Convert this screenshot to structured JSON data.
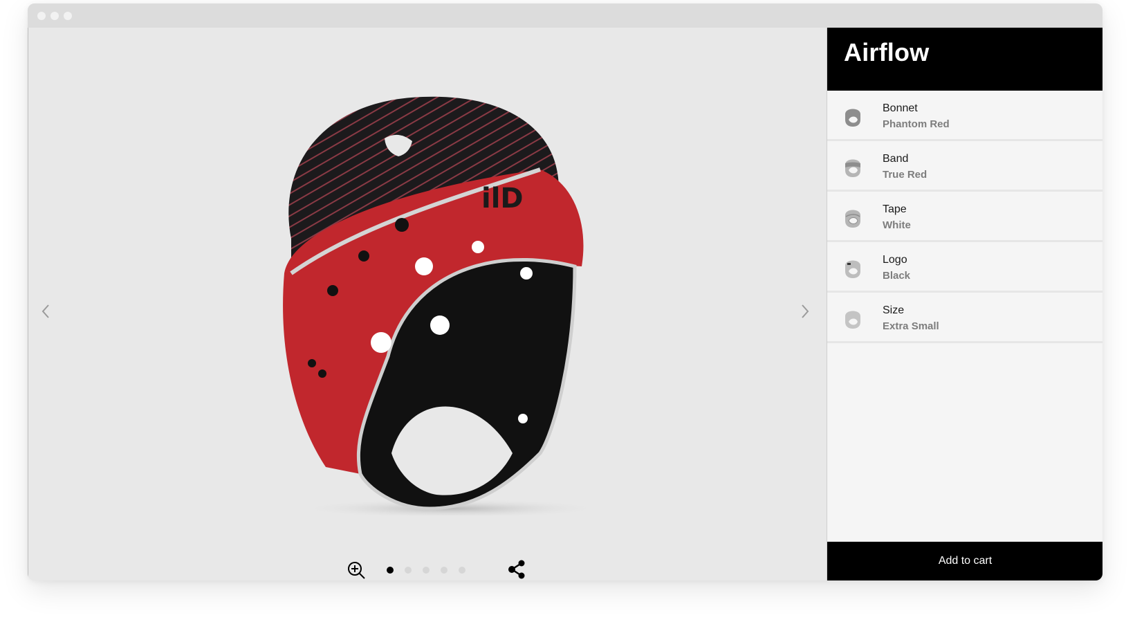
{
  "window": {
    "controls": [
      "close",
      "minimize",
      "maximize"
    ]
  },
  "viewer": {
    "prev_icon": "chevron-left-icon",
    "next_icon": "chevron-right-icon",
    "zoom_icon": "zoom-in-icon",
    "share_icon": "share-icon",
    "pages": 5,
    "active_page": 1,
    "product_image": "rugby-headguard-red-black"
  },
  "panel": {
    "title": "Airflow",
    "options": [
      {
        "label": "Bonnet",
        "value": "Phantom Red",
        "icon": "helmet-bonnet-icon"
      },
      {
        "label": "Band",
        "value": "True Red",
        "icon": "helmet-band-icon"
      },
      {
        "label": "Tape",
        "value": "White",
        "icon": "helmet-tape-icon"
      },
      {
        "label": "Logo",
        "value": "Black",
        "icon": "helmet-logo-icon"
      },
      {
        "label": "Size",
        "value": "Extra Small",
        "icon": "helmet-size-icon"
      }
    ],
    "cart_button": "Add to cart"
  },
  "colors": {
    "header_bg": "#000000",
    "stage_bg": "#e8e8e8",
    "panel_bg": "#f5f5f5",
    "band_red": "#c1272d",
    "value_gray": "#7d7d7d"
  }
}
